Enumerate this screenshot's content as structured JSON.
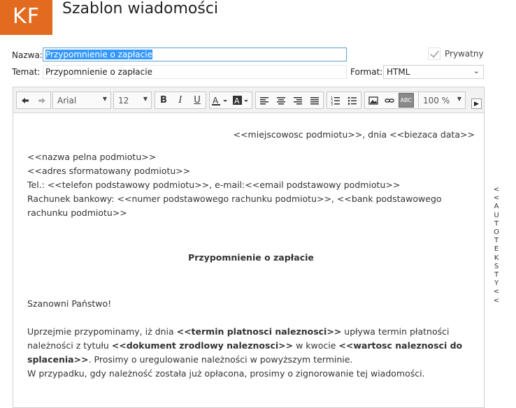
{
  "header": {
    "logo": "KF",
    "title": "Szablon wiadomości"
  },
  "form": {
    "name_label": "Nazwa:",
    "name_value": "Przypomnienie o zapłacie",
    "subject_label": "Temat:",
    "subject_value": "Przypomnienie o zapłacie",
    "private_label": "Prywatny",
    "format_label": "Format:",
    "format_value": "HTML"
  },
  "toolbar": {
    "font_family": "Arial",
    "font_size": "12",
    "bold": "B",
    "italic": "I",
    "underline": "U",
    "spell": "ABC",
    "zoom": "100 %",
    "more": "▶"
  },
  "document": {
    "place_date": "<<miejscowosc podmiotu>>, dnia <<biezaca data>>",
    "sender_lines": [
      "<<nazwa pelna podmiotu>>",
      "<<adres sformatowany podmiotu>>",
      "Tel.: <<telefon podstawowy podmiotu>>, e-mail:<<email podstawowy podmiotu>>",
      "Rachunek bankowy: <<numer podstawowego rachunku podmiotu>>, <<bank podstawowego rachunku podmiotu>>"
    ],
    "heading": "Przypomnienie o zapłacie",
    "greeting": "Szanowni Państwo!",
    "p1_a": "Uprzejmie przypominamy, iż dnia ",
    "p1_b": "<<termin platnosci naleznosci>>",
    "p1_c": " upływa termin płatności należności z tytułu ",
    "p1_d": "<<dokument zrodlowy naleznosci>>",
    "p1_e": " w kwocie ",
    "p1_f": "<<wartosc naleznosci do splacenia>>",
    "p1_g": ". Prosimy o uregulowanie należności w powyższym terminie.",
    "p2": "W przypadku, gdy należność została już opłacona, prosimy o zignorowanie tej wiadomości."
  },
  "sidebar": {
    "letters": [
      "<",
      "<",
      " ",
      "A",
      "U",
      "T",
      "O",
      "T",
      "E",
      "K",
      "S",
      "T",
      "Y",
      " ",
      "<",
      "<"
    ]
  }
}
